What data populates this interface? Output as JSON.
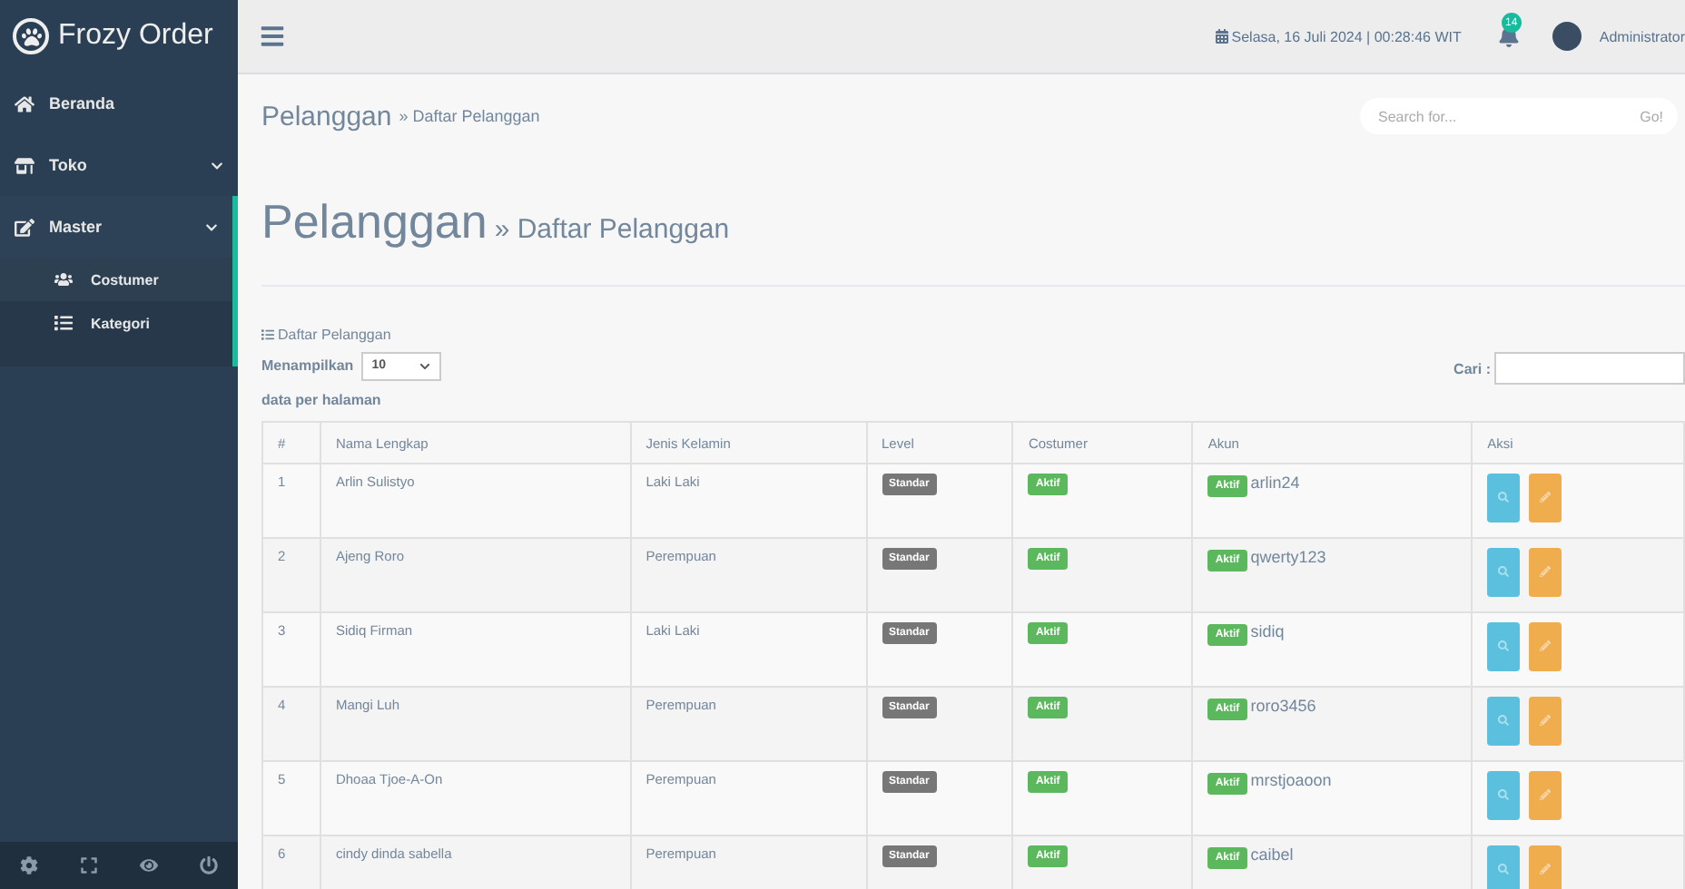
{
  "brand": {
    "name": "Frozy Order"
  },
  "sidebar": {
    "items": [
      {
        "label": "Beranda",
        "kind": "link",
        "selected": false
      },
      {
        "label": "Toko",
        "kind": "menu",
        "selected": false
      },
      {
        "label": "Master",
        "kind": "menu",
        "expanded": true,
        "selected": true,
        "children": [
          {
            "label": "Costumer",
            "selected": true
          },
          {
            "label": "Kategori",
            "selected": false
          }
        ]
      }
    ]
  },
  "topbar": {
    "datetime": "Selasa, 16 Juli 2024 | 00:28:46 WIT",
    "notification_count": "14",
    "user": "Administrator"
  },
  "breadcrumb": {
    "title": "Pelanggan",
    "sub": "» Daftar Pelanggan"
  },
  "search": {
    "placeholder": "Search for...",
    "button": "Go!"
  },
  "page_heading": {
    "title": "Pelanggan",
    "sub": "» Daftar Pelanggan"
  },
  "panel": {
    "title": "Daftar Pelanggan"
  },
  "length": {
    "prefix": "Menampilkan",
    "value": "10",
    "suffix": "data per halaman"
  },
  "filter": {
    "label": "Cari :"
  },
  "table": {
    "columns": [
      "#",
      "Nama Lengkap",
      "Jenis Kelamin",
      "Level",
      "Costumer",
      "Akun",
      "Aksi"
    ],
    "rows": [
      {
        "no": "1",
        "name": "Arlin Sulistyo",
        "gender": "Laki Laki",
        "level": "Standar",
        "status": "Aktif",
        "account_status": "Aktif",
        "username": "arlin24"
      },
      {
        "no": "2",
        "name": "Ajeng Roro",
        "gender": "Perempuan",
        "level": "Standar",
        "status": "Aktif",
        "account_status": "Aktif",
        "username": "qwerty123"
      },
      {
        "no": "3",
        "name": "Sidiq Firman",
        "gender": "Laki Laki",
        "level": "Standar",
        "status": "Aktif",
        "account_status": "Aktif",
        "username": "sidiq"
      },
      {
        "no": "4",
        "name": "Mangi Luh",
        "gender": "Perempuan",
        "level": "Standar",
        "status": "Aktif",
        "account_status": "Aktif",
        "username": "roro3456"
      },
      {
        "no": "5",
        "name": "Dhoaa Tjoe-A-On",
        "gender": "Perempuan",
        "level": "Standar",
        "status": "Aktif",
        "account_status": "Aktif",
        "username": "mrstjoaoon"
      },
      {
        "no": "6",
        "name": "cindy dinda sabella",
        "gender": "Perempuan",
        "level": "Standar",
        "status": "Aktif",
        "account_status": "Aktif",
        "username": "caibel"
      }
    ]
  }
}
